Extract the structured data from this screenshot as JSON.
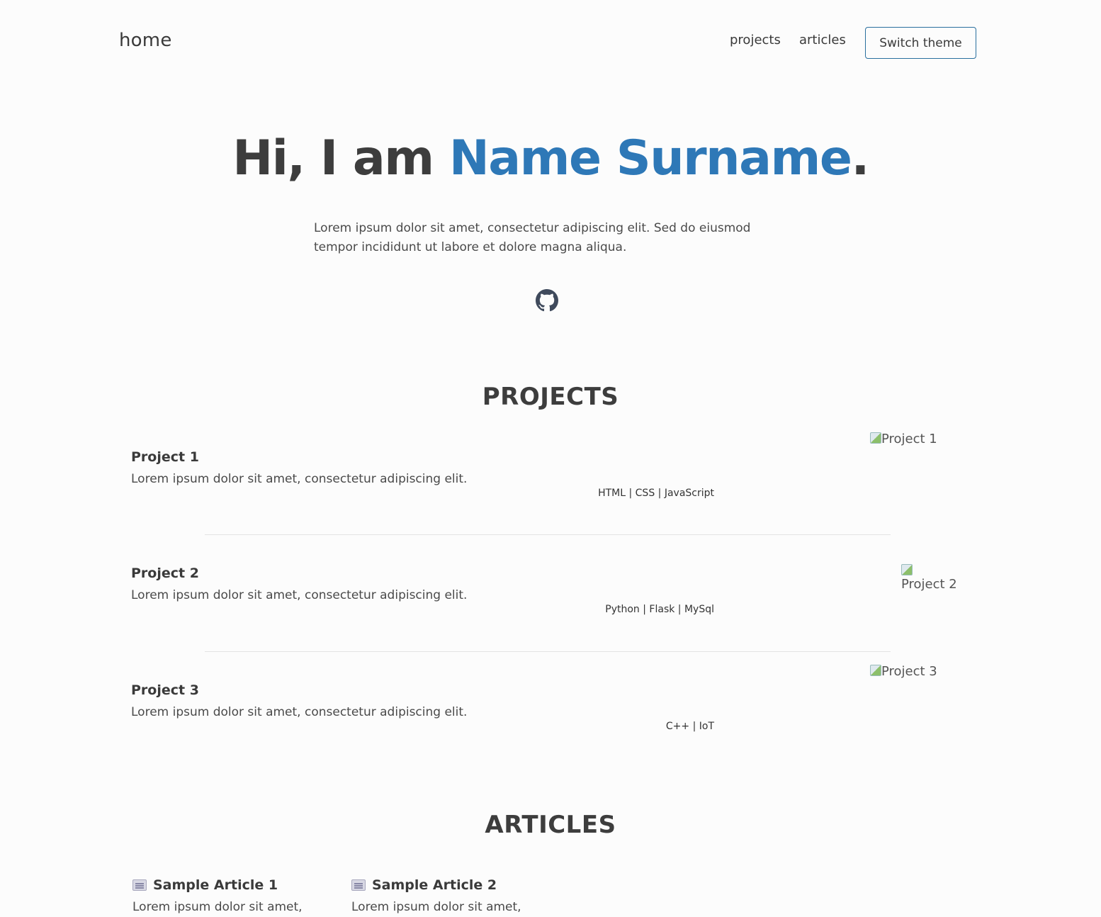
{
  "header": {
    "brand": "home",
    "nav": {
      "projects": "projects",
      "articles": "articles"
    },
    "theme_button": "Switch theme"
  },
  "hero": {
    "greeting": "Hi, I am ",
    "name": "Name Surname",
    "period": ".",
    "intro": "Lorem ipsum dolor sit amet, consectetur adipiscing elit. Sed do eiusmod tempor incididunt ut labore et dolore magna aliqua.",
    "social_icon": "github-icon"
  },
  "projects": {
    "title": "PROJECTS",
    "items": [
      {
        "title": "Project 1",
        "description": "Lorem ipsum dolor sit amet, consectetur adipiscing elit.",
        "tags": "HTML | CSS | JavaScript",
        "image_alt": "Project 1"
      },
      {
        "title": "Project 2",
        "description": "Lorem ipsum dolor sit amet, consectetur adipiscing elit.",
        "tags": "Python | Flask | MySql",
        "image_alt": "Project 2"
      },
      {
        "title": "Project 3",
        "description": "Lorem ipsum dolor sit amet, consectetur adipiscing elit.",
        "tags": "C++ | IoT",
        "image_alt": "Project 3"
      }
    ]
  },
  "articles": {
    "title": "ARTICLES",
    "items": [
      {
        "icon": "newspaper-icon",
        "title": "Sample Article 1",
        "excerpt": "Lorem ipsum dolor sit amet,"
      },
      {
        "icon": "newspaper-icon",
        "title": "Sample Article 2",
        "excerpt": "Lorem ipsum dolor sit amet,"
      }
    ]
  },
  "colors": {
    "accent": "#2e78b7",
    "text": "#3d3d3d",
    "background": "#fcfcfc",
    "button_border": "#2a6f9e"
  }
}
